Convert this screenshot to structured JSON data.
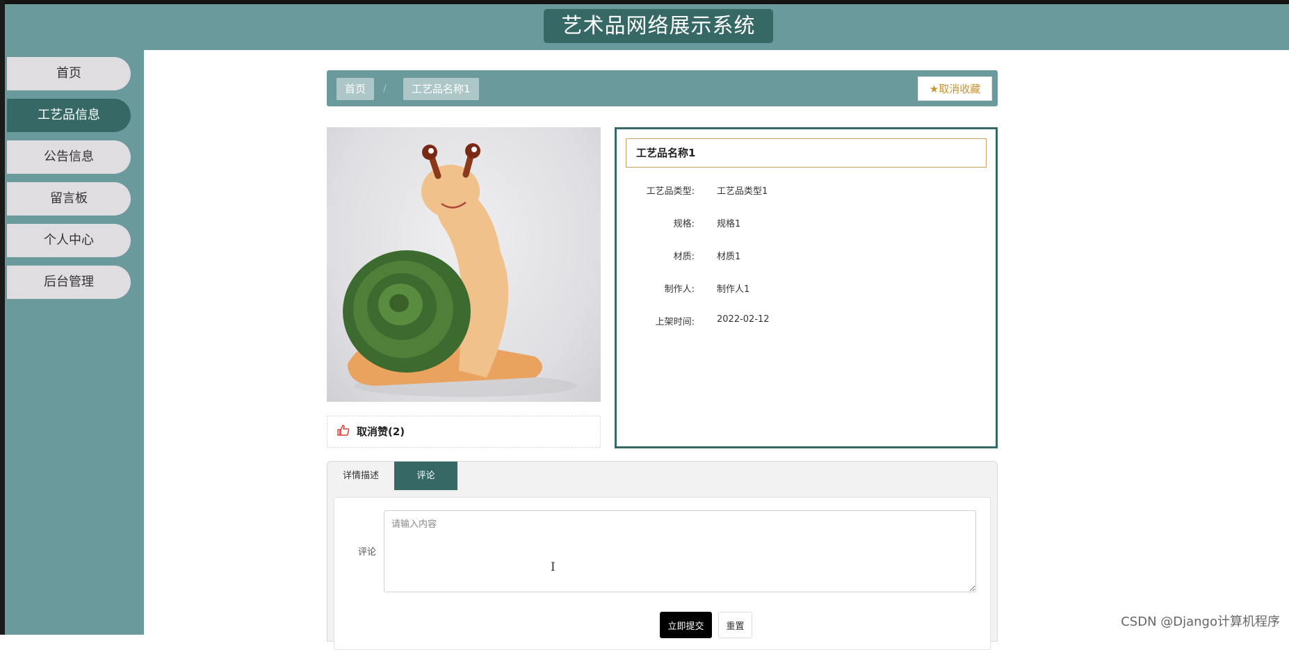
{
  "header": {
    "title": "艺术品网络展示系统"
  },
  "sidebar": {
    "items": [
      {
        "label": "首页"
      },
      {
        "label": "工艺品信息"
      },
      {
        "label": "公告信息"
      },
      {
        "label": "留言板"
      },
      {
        "label": "个人中心"
      },
      {
        "label": "后台管理"
      }
    ],
    "active_index": 1
  },
  "breadcrumb": {
    "home": "首页",
    "separator": "/",
    "current": "工艺品名称1"
  },
  "favorite": {
    "icon": "star-icon",
    "label": "★取消收藏"
  },
  "product": {
    "image_alt": "工艺品图片",
    "like_icon": "thumbs-up-icon",
    "like_label": "取消赞(2)",
    "name": "工艺品名称1",
    "fields": [
      {
        "label": "工艺品类型:",
        "value": "工艺品类型1"
      },
      {
        "label": "规格:",
        "value": "规格1"
      },
      {
        "label": "材质:",
        "value": "材质1"
      },
      {
        "label": "制作人:",
        "value": "制作人1"
      },
      {
        "label": "上架时间:",
        "value": "2022-02-12"
      }
    ]
  },
  "tabs": [
    {
      "label": "详情描述"
    },
    {
      "label": "评论"
    }
  ],
  "comment": {
    "label": "评论",
    "placeholder": "请输入内容",
    "submit": "立即提交",
    "reset": "重置"
  },
  "watermark": "CSDN @Django计算机程序",
  "colors": {
    "primary": "#6a9a9b",
    "dark": "#366966",
    "accent": "#c8932f"
  }
}
